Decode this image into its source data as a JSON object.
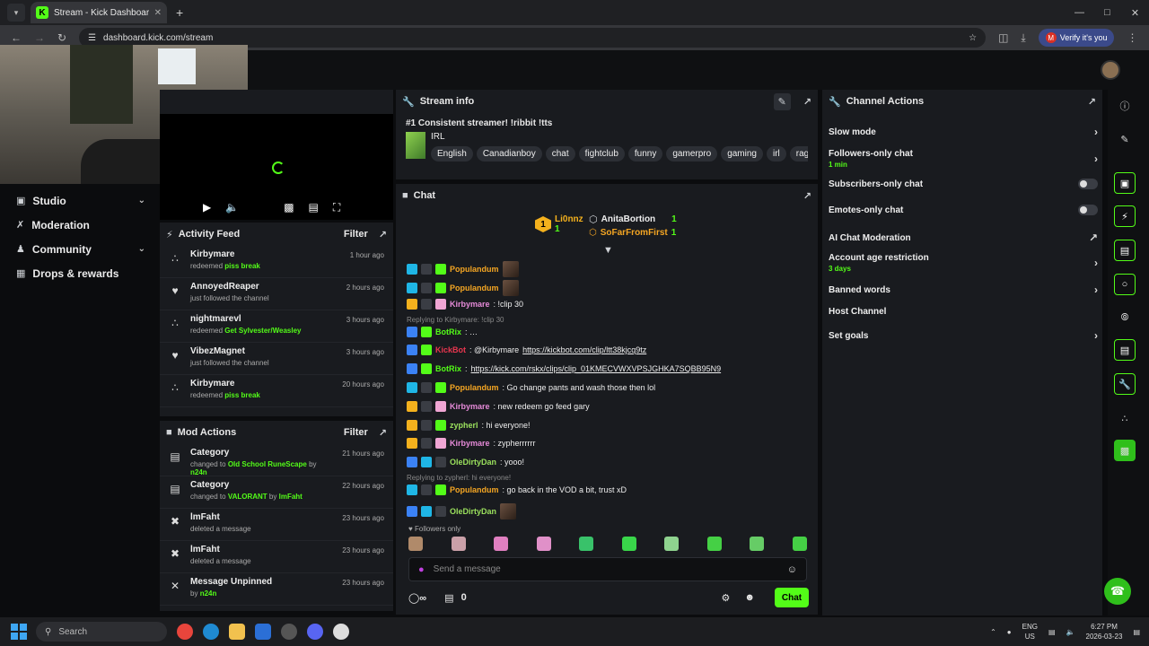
{
  "browser": {
    "tab_title": "Stream - Kick Dashboard",
    "url": "dashboard.kick.com/stream",
    "verify_label": "Verify it's you",
    "verify_initial": "M"
  },
  "nav": [
    {
      "label": "Studio",
      "icon": "studio-icon",
      "expandable": true
    },
    {
      "label": "Moderation",
      "icon": "wrench-icon",
      "expandable": false
    },
    {
      "label": "Community",
      "icon": "people-icon",
      "expandable": true
    },
    {
      "label": "Drops & rewards",
      "icon": "chart-icon",
      "expandable": false
    }
  ],
  "activity_feed": {
    "title": "Activity Feed",
    "filter_label": "Filter",
    "items": [
      {
        "user": "Kirbymare",
        "action": "redeemed",
        "highlight": "piss break",
        "time": "1 hour ago",
        "icon": "redeem-icon"
      },
      {
        "user": "AnnoyedReaper",
        "action": "just followed the channel",
        "highlight": "",
        "time": "2 hours ago",
        "icon": "heart-icon"
      },
      {
        "user": "nightmarevl",
        "action": "redeemed",
        "highlight": "Get Sylvester/Weasley",
        "time": "3 hours ago",
        "icon": "redeem-icon"
      },
      {
        "user": "VibezMagnet",
        "action": "just followed the channel",
        "highlight": "",
        "time": "3 hours ago",
        "icon": "heart-icon"
      },
      {
        "user": "Kirbymare",
        "action": "redeemed",
        "highlight": "piss break",
        "time": "20 hours ago",
        "icon": "redeem-icon"
      }
    ]
  },
  "mod_actions": {
    "title": "Mod Actions",
    "filter_label": "Filter",
    "items": [
      {
        "title": "Category",
        "pre": "changed to",
        "highlight": "Old School RuneScape",
        "by": "by",
        "actor": "n24n",
        "time": "21 hours ago",
        "icon": "category-icon"
      },
      {
        "title": "Category",
        "pre": "changed to",
        "highlight": "VALORANT",
        "by": "by",
        "actor": "lmFaht",
        "time": "22 hours ago",
        "icon": "category-icon"
      },
      {
        "title": "lmFaht",
        "pre": "deleted a message",
        "highlight": "",
        "by": "",
        "actor": "",
        "time": "23 hours ago",
        "icon": "trash-icon"
      },
      {
        "title": "lmFaht",
        "pre": "deleted a message",
        "highlight": "",
        "by": "",
        "actor": "",
        "time": "23 hours ago",
        "icon": "trash-icon"
      },
      {
        "title": "Message Unpinned",
        "pre": "",
        "highlight": "",
        "by": "by",
        "actor": "n24n",
        "time": "23 hours ago",
        "icon": "unpin-icon"
      }
    ]
  },
  "stream_info": {
    "header": "Stream info",
    "title": "#1 Consistent streamer! !ribbit !tts",
    "category": "IRL",
    "tags": [
      "English",
      "Canadianboy",
      "chat",
      "fightclub",
      "funny",
      "gamerpro",
      "gaming",
      "irl",
      "rage"
    ]
  },
  "chat": {
    "header": "Chat",
    "leaders": [
      {
        "name": "Li0nnz",
        "count": "1",
        "rank": "1"
      },
      {
        "name": "AnitaBortion",
        "count": "1"
      },
      {
        "name": "SoFarFromFirst",
        "count": "1"
      }
    ],
    "messages": [
      {
        "name": "Populandum",
        "text": "",
        "emote": true
      },
      {
        "name": "Populandum",
        "text": "",
        "emote": true
      },
      {
        "name": "Kirbymare",
        "text": ": !clip 30"
      },
      {
        "reply": "Replying to Kirbymare: !clip 30"
      },
      {
        "name": "BotRix",
        "text": ": …"
      },
      {
        "name": "KickBot",
        "text": ": @Kirbymare ",
        "link": "https://kickbot.com/clip/ltt38kjcq9tz"
      },
      {
        "name": "BotRix",
        "text": ": ",
        "link": "https://kick.com/rskx/clips/clip_01KMECVWXVPSJGHKA7SQBB95N9"
      },
      {
        "name": "Populandum",
        "text": ": Go change pants and wash those then lol"
      },
      {
        "name": "Kirbymare",
        "text": ": new redeem go feed gary"
      },
      {
        "name": "zypherl",
        "text": ": hi everyone!"
      },
      {
        "name": "Kirbymare",
        "text": ": zypherrrrrr"
      },
      {
        "name": "OleDirtyDan",
        "text": ": yooo!"
      },
      {
        "reply": "Replying to zypherl: hi everyone!"
      },
      {
        "name": "Populandum",
        "text": ": go back in the VOD a bit, trust xD"
      },
      {
        "name": "OleDirtyDan",
        "text": "",
        "emote": true
      }
    ],
    "followers_only": "Followers only",
    "input_placeholder": "Send a message",
    "points": "0",
    "send_label": "Chat"
  },
  "channel_actions": {
    "header": "Channel Actions",
    "items": [
      {
        "label": "Slow mode",
        "sub": "",
        "control": "chevron"
      },
      {
        "label": "Followers-only chat",
        "sub": "1 min",
        "control": "chevron"
      },
      {
        "label": "Subscribers-only chat",
        "sub": "",
        "control": "toggle"
      },
      {
        "label": "Emotes-only chat",
        "sub": "",
        "control": "toggle"
      },
      {
        "label": "AI Chat Moderation",
        "sub": "",
        "control": "external"
      },
      {
        "label": "Account age restriction",
        "sub": "3 days",
        "control": "chevron"
      },
      {
        "label": "Banned words",
        "sub": "",
        "control": "chevron"
      },
      {
        "label": "Host Channel",
        "sub": "",
        "control": "none"
      },
      {
        "label": "Set goals",
        "sub": "",
        "control": "chevron"
      }
    ]
  },
  "taskbar": {
    "search_placeholder": "Search",
    "lang_top": "ENG",
    "lang_bottom": "US",
    "time": "6:27 PM",
    "date": "2026-03-23"
  },
  "colors": {
    "accent": "#53fc18",
    "panel": "#191b1f",
    "bg": "#0b0c0e"
  }
}
